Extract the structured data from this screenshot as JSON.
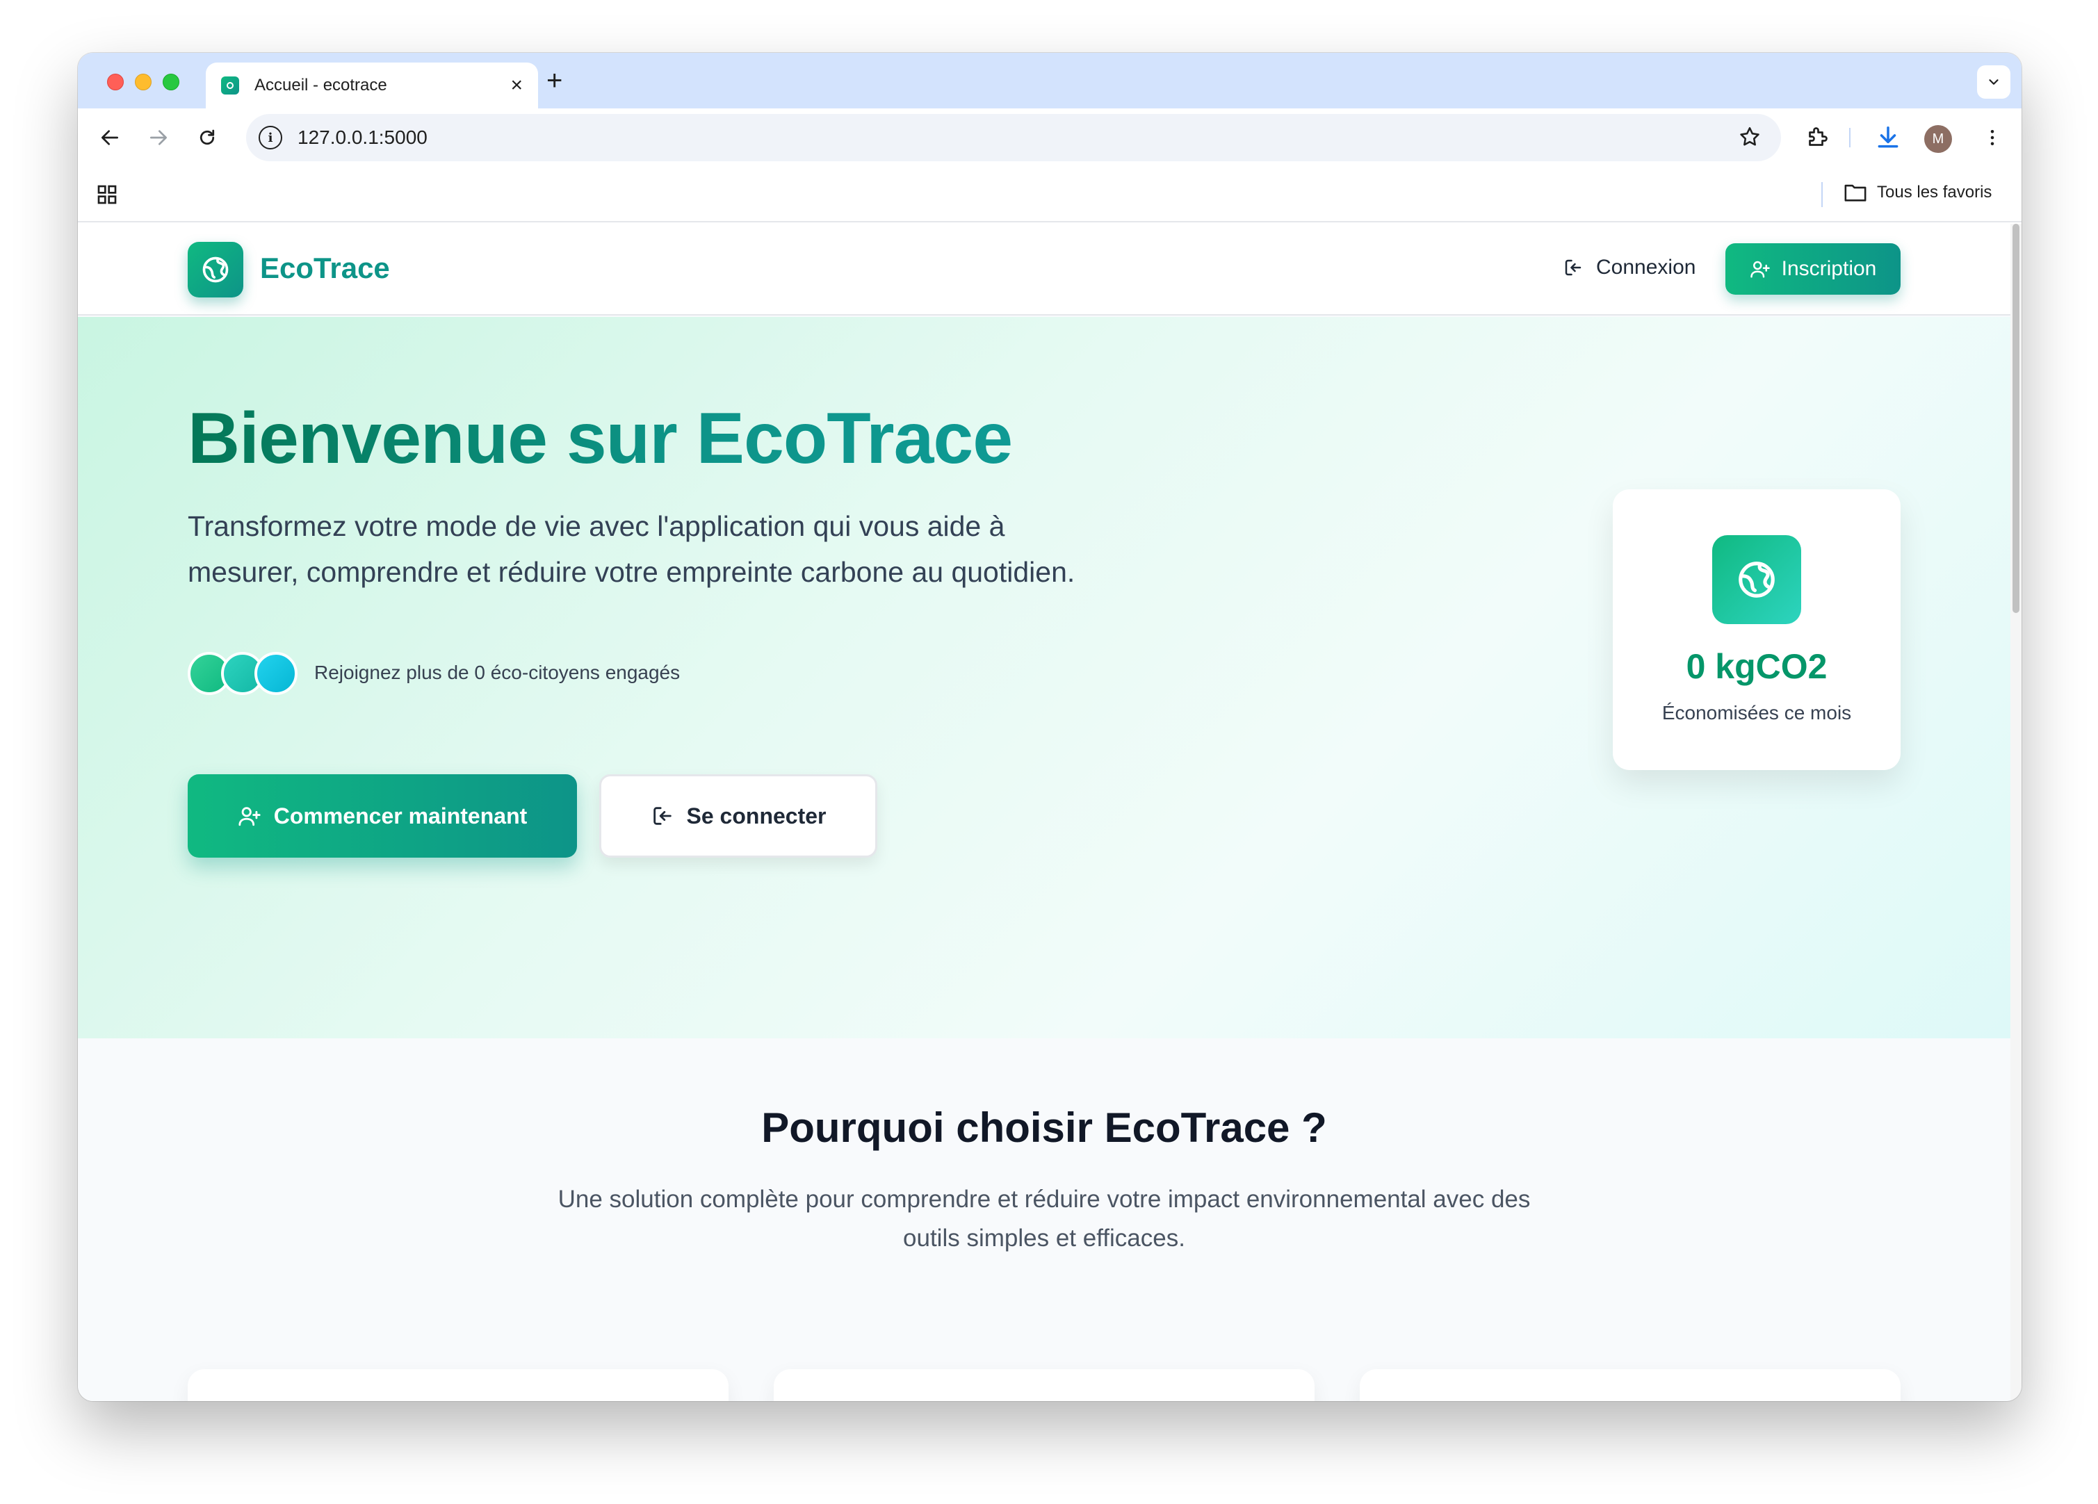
{
  "browser": {
    "tab_title": "Accueil - ecotrace",
    "url": "127.0.0.1:5000",
    "avatar_initial": "M",
    "bookmarks_folder": "Tous les favoris"
  },
  "navbar": {
    "brand": "EcoTrace",
    "login_label": "Connexion",
    "signup_label": "Inscription"
  },
  "hero": {
    "title": "Bienvenue sur EcoTrace",
    "subtitle_line1": "Transformez votre mode de vie avec l'application qui vous aide à",
    "subtitle_line2": "mesurer, comprendre et réduire votre empreinte carbone au quotidien.",
    "join_text": "Rejoignez plus de 0 éco-citoyens engagés",
    "cta_primary": "Commencer maintenant",
    "cta_secondary": "Se connecter"
  },
  "stat_card": {
    "value": "0 kgCO2",
    "label": "Économisées ce mois"
  },
  "features": {
    "title": "Pourquoi choisir EcoTrace ?",
    "subtitle_line1": "Une solution complète pour comprendre et réduire votre impact environnemental avec des",
    "subtitle_line2": "outils simples et efficaces.",
    "cards": [
      {
        "icon": "chart-bar-icon",
        "color_from": "#10b981",
        "color_to": "#0d9488"
      },
      {
        "icon": "lightbulb-icon",
        "color_from": "#14b8a6",
        "color_to": "#0891b2"
      },
      {
        "icon": "presentation-chart-icon",
        "color_from": "#0ea5e9",
        "color_to": "#2563eb"
      }
    ]
  },
  "colors": {
    "brand": "#0d9488",
    "brand_light": "#10b981",
    "stat_value": "#059669"
  }
}
